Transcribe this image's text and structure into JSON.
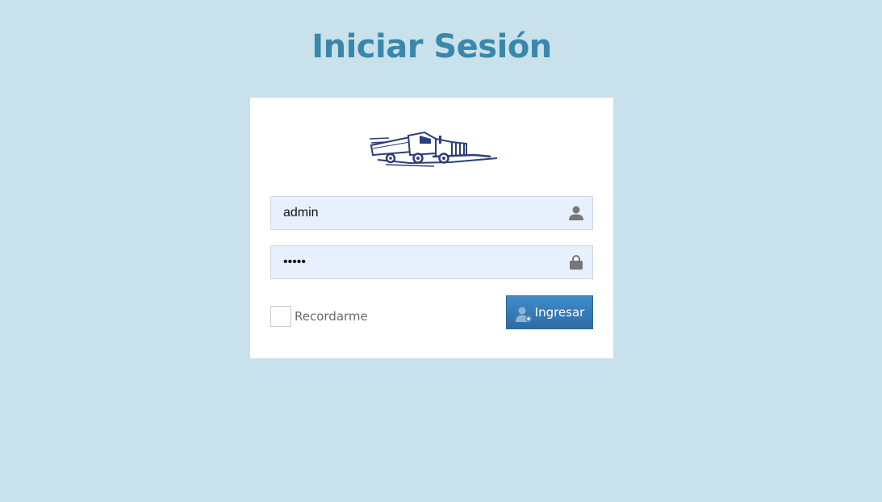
{
  "header": {
    "title": "Iniciar Sesión"
  },
  "login": {
    "logo_icon": "truck-logo-icon",
    "username": {
      "value": "admin",
      "icon": "user-icon"
    },
    "password": {
      "value": "admin",
      "icon": "lock-icon"
    },
    "remember": {
      "label": "Recordarme",
      "checked": false
    },
    "submit": {
      "label": "Ingresar",
      "icon": "user-add-icon"
    }
  },
  "colors": {
    "background": "#c8e1ea",
    "title": "#3a87ad",
    "button": "#337ab7",
    "field_bg": "#e8f0fe",
    "logo": "#2c3e7a"
  }
}
